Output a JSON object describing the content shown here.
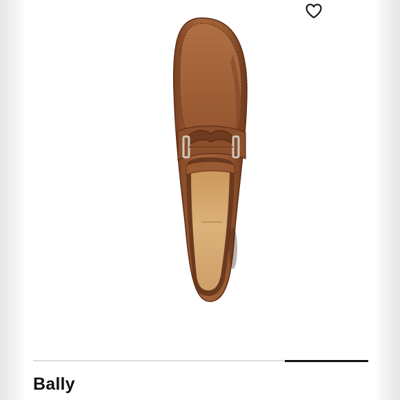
{
  "listing": {
    "brand": "Bally",
    "image_carousel": {
      "slide_count": 5,
      "current_slide": 5,
      "progress_fraction": 0.25
    },
    "like_icon": "heart-outline-icon"
  },
  "colors": {
    "page_background": "#f2f2f2",
    "card_background": "#ffffff",
    "leather": "#9b5a32",
    "leather_dark": "#6e3b1f",
    "insole": "#d9ac74",
    "hardware": "#c9c3b6",
    "progress_track": "#dcdcdc",
    "progress_fill": "#111111",
    "text": "#111111"
  }
}
